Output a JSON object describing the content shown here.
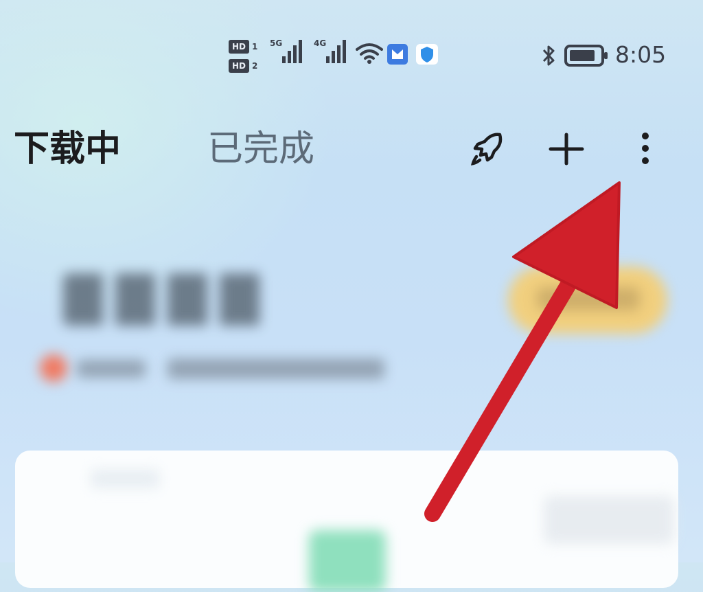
{
  "status_bar": {
    "hd_badge_1": "HD",
    "hd_badge_1_num": "1",
    "hd_badge_2": "HD",
    "hd_badge_2_num": "2",
    "signal_1_label": "5G",
    "signal_2_label": "4G",
    "time": "8:05"
  },
  "header": {
    "tabs": [
      {
        "label": "下载中",
        "active": true
      },
      {
        "label": "已完成",
        "active": false
      }
    ],
    "icons": [
      "rocket-icon",
      "plus-icon",
      "more-vertical-icon"
    ]
  },
  "colors": {
    "active_tab": "#1c1c1e",
    "inactive_tab": "#5c6a78",
    "arrow": "#d0202a",
    "pill": "#f1cf7e",
    "accent_green": "#8fe0be"
  }
}
